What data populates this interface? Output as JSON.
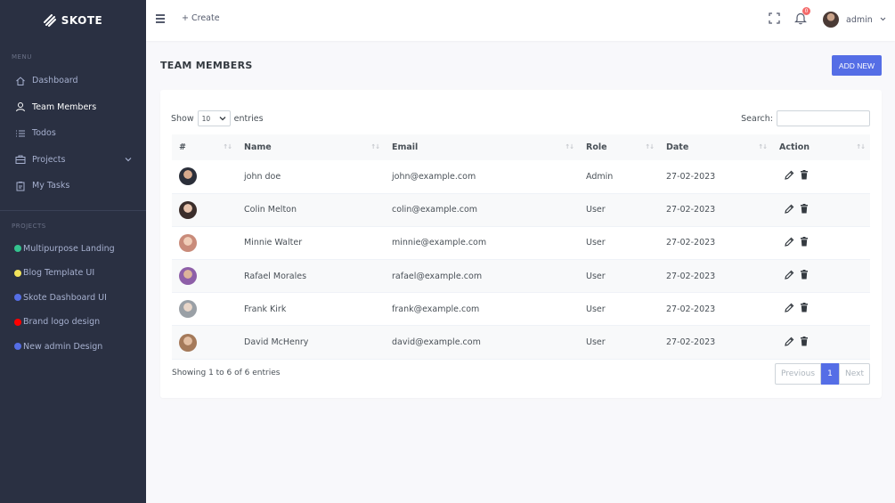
{
  "brand": {
    "name": "SKOTE"
  },
  "sidebar": {
    "menu_title": "MENU",
    "items": [
      {
        "label": "Dashboard",
        "icon": "home-icon"
      },
      {
        "label": "Team Members",
        "icon": "user-icon"
      },
      {
        "label": "Todos",
        "icon": "list-icon"
      },
      {
        "label": "Projects",
        "icon": "briefcase-icon"
      },
      {
        "label": "My Tasks",
        "icon": "clipboard-icon"
      }
    ],
    "projects_title": "PROJECTS",
    "projects": [
      {
        "label": "Multipurpose Landing",
        "color": "#34c38f"
      },
      {
        "label": "Blog Template UI",
        "color": "#f1e35b"
      },
      {
        "label": "Skote Dashboard UI",
        "color": "#556ee6"
      },
      {
        "label": "Brand logo design",
        "color": "#ff0000"
      },
      {
        "label": "New admin Design",
        "color": "#556ee6"
      }
    ]
  },
  "topbar": {
    "create_label": "Create",
    "notification_count": "0",
    "user_name": "admin"
  },
  "page": {
    "title": "TEAM MEMBERS",
    "add_new_label": "ADD NEW"
  },
  "table": {
    "show_label": "Show",
    "entries_label": "entries",
    "page_size": "10",
    "search_label": "Search:",
    "columns": [
      "#",
      "Name",
      "Email",
      "Role",
      "Date",
      "Action"
    ],
    "rows": [
      {
        "name": "john doe",
        "email": "john@example.com",
        "role": "Admin",
        "date": "27-02-2023",
        "avatar_color": "#2b2f3a"
      },
      {
        "name": "Colin Melton",
        "email": "colin@example.com",
        "role": "User",
        "date": "27-02-2023",
        "avatar_color": "#6b5a55"
      },
      {
        "name": "Minnie Walter",
        "email": "minnie@example.com",
        "role": "User",
        "date": "27-02-2023",
        "avatar_color": "#c98b7a"
      },
      {
        "name": "Rafael Morales",
        "email": "rafael@example.com",
        "role": "User",
        "date": "27-02-2023",
        "avatar_color": "#8e5fa8"
      },
      {
        "name": "Frank Kirk",
        "email": "frank@example.com",
        "role": "User",
        "date": "27-02-2023",
        "avatar_color": "#9aa0a6"
      },
      {
        "name": "David McHenry",
        "email": "david@example.com",
        "role": "User",
        "date": "27-02-2023",
        "avatar_color": "#a57a5a"
      }
    ],
    "info": "Showing 1 to 6 of 6 entries",
    "pagination": {
      "prev": "Previous",
      "current": "1",
      "next": "Next"
    }
  },
  "colors": {
    "sidebar_bg": "#2a3042",
    "primary": "#556ee6",
    "badge": "#f46a6a"
  }
}
